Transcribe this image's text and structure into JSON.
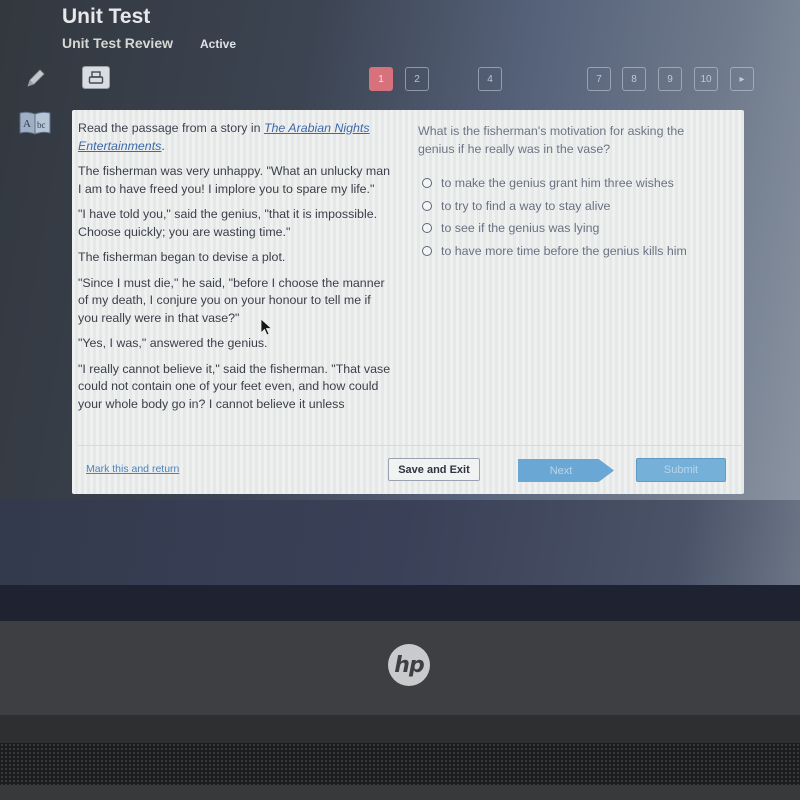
{
  "header": {
    "title": "Unit Test",
    "subtitle": "Unit Test Review",
    "status": "Active"
  },
  "toolbar": {
    "icons": [
      "pencil-icon",
      "print-icon",
      "dictionary-icon"
    ],
    "dictionary_label": "Abc"
  },
  "pagination": {
    "current": "1",
    "pages": [
      "1",
      "2",
      "4",
      "7",
      "8",
      "9",
      "10"
    ],
    "next_glyph": "▸"
  },
  "passage": {
    "intro_prefix": "Read the passage from a story in ",
    "intro_link": "The Arabian Nights Entertainments",
    "intro_suffix": ".",
    "paragraphs": [
      "The fisherman was very unhappy. \"What an unlucky man I am to have freed you! I implore you to spare my life.\"",
      "\"I have told you,\" said the genius, \"that it is impossible. Choose quickly; you are wasting time.\"",
      "The fisherman began to devise a plot.",
      "\"Since I must die,\" he said, \"before I choose the manner of my death, I conjure you on your honour to tell me if you really were in that vase?\"",
      "\"Yes, I was,\" answered the genius.",
      "\"I really cannot believe it,\" said the fisherman. \"That vase could not contain one of your feet even, and how could your whole body go in? I cannot believe it unless"
    ]
  },
  "question": {
    "prompt": "What is the fisherman's motivation for asking the genius if he really was in the vase?",
    "options": [
      "to make the genius grant him three wishes",
      "to try to find a way to stay alive",
      "to see if the genius was lying",
      "to have more time before the genius kills him"
    ],
    "selected": null
  },
  "footer": {
    "mark_link": "Mark this and return",
    "save_label": "Save and Exit",
    "next_label": "Next",
    "submit_label": "Submit"
  },
  "device": {
    "logo": "hp"
  },
  "colors": {
    "current_page": "#d7727c",
    "link": "#3d68a8",
    "next_button": "#6aa7d4",
    "submit_button": "#75b0d9"
  }
}
